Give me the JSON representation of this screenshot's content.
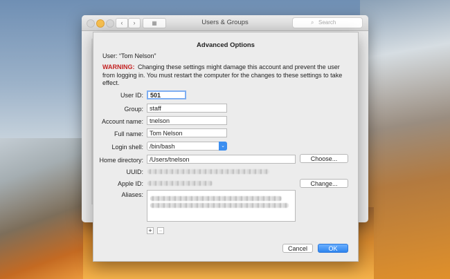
{
  "window": {
    "title": "Users & Groups",
    "nav_back": "‹",
    "nav_forward": "›",
    "grid_icon": "▦",
    "search_placeholder": "Search",
    "search_icon": "⌕"
  },
  "sheet": {
    "title": "Advanced Options",
    "user_line": "User:  “Tom Nelson”",
    "warning_label": "WARNING:",
    "warning_text": "Changing these settings might damage this account and prevent the user from logging in. You must restart the computer for the changes to these settings to take effect.",
    "fields": {
      "user_id": {
        "label": "User ID:",
        "value": "501"
      },
      "group": {
        "label": "Group:",
        "value": "staff"
      },
      "account_name": {
        "label": "Account name:",
        "value": "tnelson"
      },
      "full_name": {
        "label": "Full name:",
        "value": "Tom Nelson"
      },
      "login_shell": {
        "label": "Login shell:",
        "value": "/bin/bash"
      },
      "home_directory": {
        "label": "Home directory:",
        "value": "/Users/tnelson"
      },
      "uuid": {
        "label": "UUID:"
      },
      "apple_id": {
        "label": "Apple ID:"
      },
      "aliases": {
        "label": "Aliases:"
      }
    },
    "buttons": {
      "choose": "Choose...",
      "change": "Change...",
      "add": "+",
      "remove": "−",
      "cancel": "Cancel",
      "ok": "OK"
    },
    "popup_arrow": "⌄"
  }
}
